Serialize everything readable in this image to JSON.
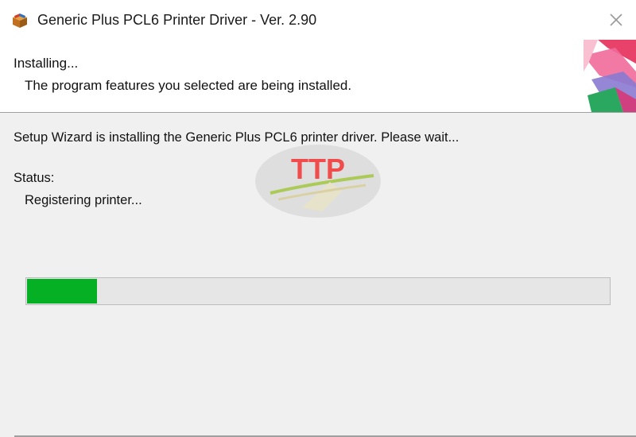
{
  "window": {
    "title": "Generic Plus PCL6 Printer Driver - Ver. 2.90",
    "app_icon": "installer-box-icon",
    "close_icon": "close-icon"
  },
  "header": {
    "title": "Installing...",
    "description": "The program features you selected are being installed."
  },
  "main": {
    "intro_text": "Setup Wizard is installing the Generic Plus PCL6 printer driver. Please wait...",
    "status_label": "Status:",
    "status_value": "Registering printer...",
    "progress_fraction": 0.12
  },
  "watermark": {
    "text": "TTP"
  },
  "colors": {
    "progress_fill": "#06b025",
    "watermark_red": "#f04444",
    "watermark_green": "#a8c850"
  }
}
